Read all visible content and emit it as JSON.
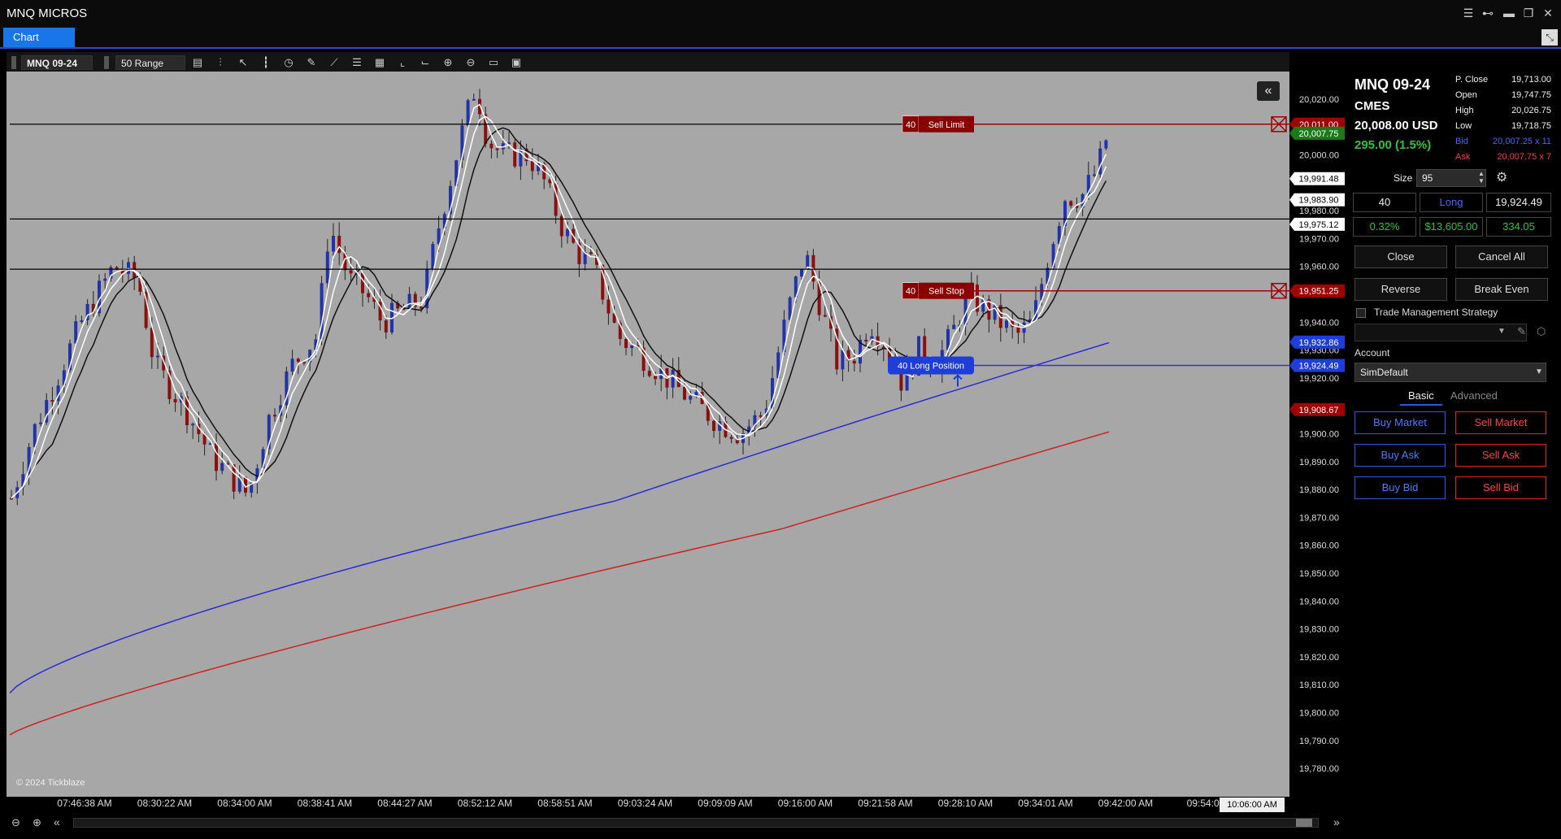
{
  "app": {
    "title": "MNQ MICROS"
  },
  "tabs": [
    {
      "label": "Chart"
    }
  ],
  "toolbar": {
    "instrument": "MNQ 09-24",
    "period": "50 Range"
  },
  "chart": {
    "watermark": "© 2024 Tickblaze",
    "y_ticks": [
      "20,020.00",
      "20,000.00",
      "19,980.00",
      "19,970.00",
      "19,960.00",
      "19,940.00",
      "19,930.00",
      "19,920.00",
      "19,900.00",
      "19,890.00",
      "19,880.00",
      "19,870.00",
      "19,860.00",
      "19,850.00",
      "19,840.00",
      "19,830.00",
      "19,820.00",
      "19,810.00",
      "19,800.00",
      "19,790.00",
      "19,780.00"
    ],
    "y_tick_values": [
      20020,
      20000,
      19980,
      19970,
      19960,
      19940,
      19930,
      19920,
      19900,
      19890,
      19880,
      19870,
      19860,
      19850,
      19840,
      19830,
      19820,
      19810,
      19800,
      19790,
      19780
    ],
    "x_ticks": [
      "07:46:38 AM",
      "08:30:22 AM",
      "08:34:00 AM",
      "08:38:41 AM",
      "08:44:27 AM",
      "08:52:12 AM",
      "08:58:51 AM",
      "09:03:24 AM",
      "09:09:09 AM",
      "09:16:00 AM",
      "09:21:58 AM",
      "09:28:10 AM",
      "09:34:01 AM",
      "09:42:00 AM",
      "09:54:00"
    ],
    "crosshair_time": "10:06:00 AM",
    "price_tags": [
      {
        "text": "20,011.00",
        "value": 20011.0,
        "style": "red"
      },
      {
        "text": "20,007.75",
        "value": 20007.75,
        "style": "green"
      },
      {
        "text": "19,991.48",
        "value": 19991.48,
        "style": "white"
      },
      {
        "text": "19,983.90",
        "value": 19983.9,
        "style": "white"
      },
      {
        "text": "19,975.12",
        "value": 19975.12,
        "style": "white"
      },
      {
        "text": "19,951.25",
        "value": 19951.25,
        "style": "red"
      },
      {
        "text": "19,932.86",
        "value": 19932.86,
        "style": "blue"
      },
      {
        "text": "19,924.49",
        "value": 19924.49,
        "style": "blue"
      },
      {
        "text": "19,908.67",
        "value": 19908.67,
        "style": "red"
      }
    ],
    "orders": [
      {
        "qty": "40",
        "label": "Sell Limit",
        "value": 20011.0
      },
      {
        "qty": "40",
        "label": "Sell Stop",
        "value": 19951.25
      }
    ],
    "position": {
      "label": "40 Long Position",
      "value": 19924.49
    },
    "horizontal_lines": [
      20011.0,
      19977.0,
      19959.0
    ],
    "colors": {
      "background": "#a7a7a7",
      "up": "#2233aa",
      "down": "#8a1010",
      "ma_blue": "#2a2ad8",
      "ma_red": "#d02020",
      "ma_white": "#ffffff",
      "ma_black": "#111111"
    }
  },
  "panel": {
    "symbol": "MNQ 09-24",
    "exchange": "CMES",
    "price": "20,008.00 USD",
    "change": "295.00 (1.5%)",
    "stats": [
      {
        "label": "P. Close",
        "value": "19,713.00",
        "color": "#eee"
      },
      {
        "label": "Open",
        "value": "19,747.75",
        "color": "#eee"
      },
      {
        "label": "High",
        "value": "20,026.75",
        "color": "#eee"
      },
      {
        "label": "Low",
        "value": "19,718.75",
        "color": "#eee"
      },
      {
        "label": "Bid",
        "value": "20,007.25 x 11",
        "color": "#3b6bff"
      },
      {
        "label": "Ask",
        "value": "20,007.75 x 7",
        "color": "#ff3b3b"
      }
    ],
    "size_label": "Size",
    "size_value": "95",
    "position_row": [
      "40",
      "Long",
      "19,924.49"
    ],
    "pnl_row": [
      "0.32%",
      "$13,605.00",
      "334.05"
    ],
    "btn_close": "Close",
    "btn_cancel_all": "Cancel All",
    "btn_reverse": "Reverse",
    "btn_break_even": "Break Even",
    "tms_label": "Trade Management Strategy",
    "account_label": "Account",
    "account_value": "SimDefault",
    "tab_basic": "Basic",
    "tab_advanced": "Advanced",
    "buy_market": "Buy Market",
    "sell_market": "Sell Market",
    "buy_ask": "Buy Ask",
    "sell_ask": "Sell Ask",
    "buy_bid": "Buy Bid",
    "sell_bid": "Sell Bid"
  }
}
